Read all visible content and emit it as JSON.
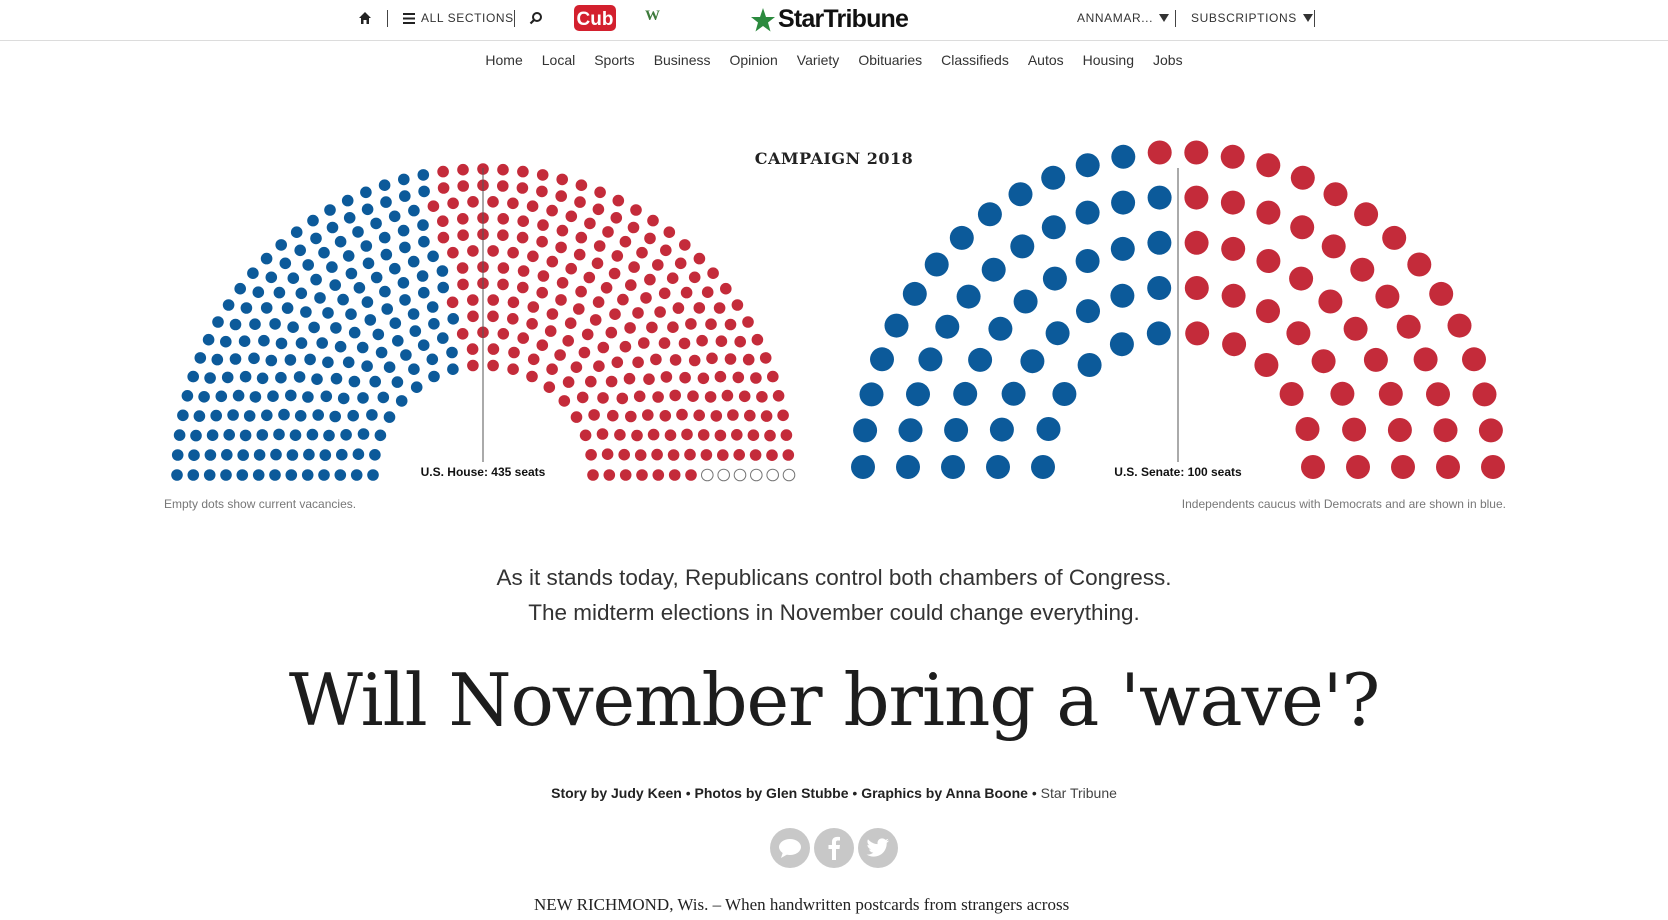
{
  "topbar": {
    "all_sections": "ALL SECTIONS",
    "user": "ANNAMAR...",
    "subscriptions": "SUBSCRIPTIONS",
    "brand": "StarTribune",
    "cub_logo": "Cub",
    "w_logo": "W",
    "icons": [
      "home-icon",
      "hamburger-icon",
      "search-icon",
      "star-icon",
      "dropdown-triangle-icon"
    ]
  },
  "nav": [
    "Home",
    "Local",
    "Sports",
    "Business",
    "Opinion",
    "Variety",
    "Obituaries",
    "Classifieds",
    "Autos",
    "Housing",
    "Jobs"
  ],
  "kicker": "CAMPAIGN 2018",
  "colors": {
    "democrat": "#0c5a9a",
    "republican": "#c42b3a",
    "vacancy": "#ffffff"
  },
  "chart_data": [
    {
      "type": "parliament",
      "chamber": "U.S. House",
      "label": "U.S. House: 435 seats",
      "total_seats": 435,
      "series": [
        {
          "party": "Democrat",
          "seats": 193,
          "color": "#0c5a9a"
        },
        {
          "party": "Republican",
          "seats": 236,
          "color": "#c42b3a"
        },
        {
          "party": "Vacant",
          "seats": 6,
          "color": "#ffffff"
        }
      ]
    },
    {
      "type": "parliament",
      "chamber": "U.S. Senate",
      "label": "U.S. Senate: 100 seats",
      "total_seats": 100,
      "series": [
        {
          "party": "Democrat",
          "seats": 49,
          "color": "#0c5a9a"
        },
        {
          "party": "Republican",
          "seats": 51,
          "color": "#c42b3a"
        }
      ]
    }
  ],
  "notes": {
    "vacancies": "Empty dots show current vacancies.",
    "independents": "Independents caucus with Democrats and are shown in blue."
  },
  "deck": [
    "As it stands today, Republicans control both chambers of Congress.",
    "The midterm elections in November could change everything."
  ],
  "headline": "Will November bring a 'wave'?",
  "byline": {
    "story": "Story by Judy Keen",
    "photos": "Photos by Glen Stubbe",
    "graphics": "Graphics by Anna Boone",
    "org": "Star Tribune"
  },
  "share_icons": [
    "comment-icon",
    "facebook-icon",
    "twitter-icon"
  ],
  "body": {
    "line1": "NEW RICHMOND, Wis. – When handwritten postcards from strangers across"
  }
}
